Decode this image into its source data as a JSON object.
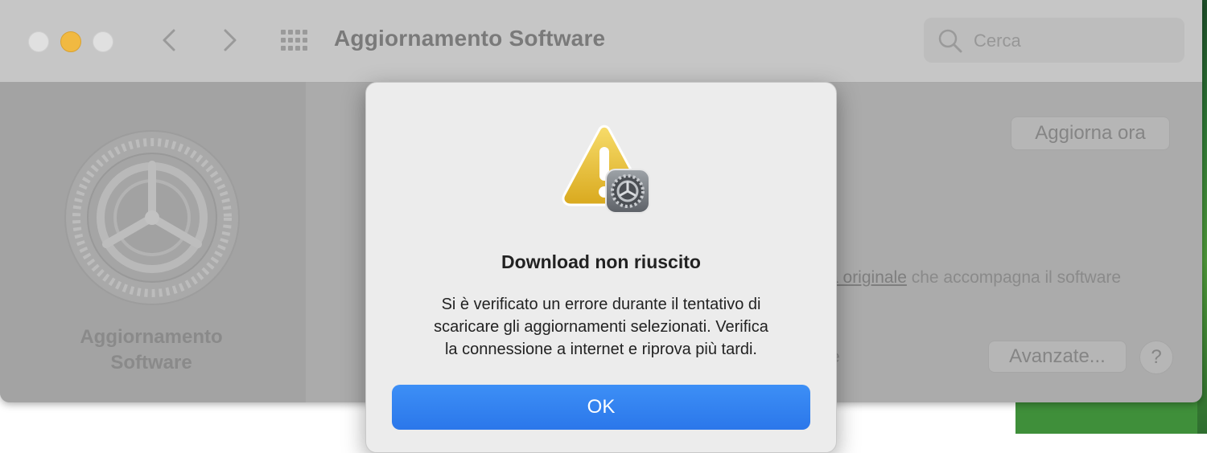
{
  "window": {
    "title": "Aggiornamento Software",
    "search": {
      "placeholder": "Cerca"
    }
  },
  "sidebar": {
    "label_line1": "Aggiornamento",
    "label_line2": "Software"
  },
  "content": {
    "update_now_label": "Aggiorna ora",
    "license_link_fragment": "a originale",
    "license_text_rest": " che accompagna il software",
    "partial_fragment": "e",
    "advanced_label": "Avanzate...",
    "help_label": "?"
  },
  "dialog": {
    "title": "Download non riuscito",
    "message_lines": [
      "Si è verificato un errore durante il tentativo di",
      "scaricare gli aggiornamenti selezionati. Verifica",
      "la connessione a internet e riprova più tardi."
    ],
    "ok_label": "OK",
    "icon": "warning-with-gear-icon"
  },
  "colors": {
    "accent": "#2b77ea",
    "warning": "#f2c94c",
    "minimize": "#f1b941"
  }
}
